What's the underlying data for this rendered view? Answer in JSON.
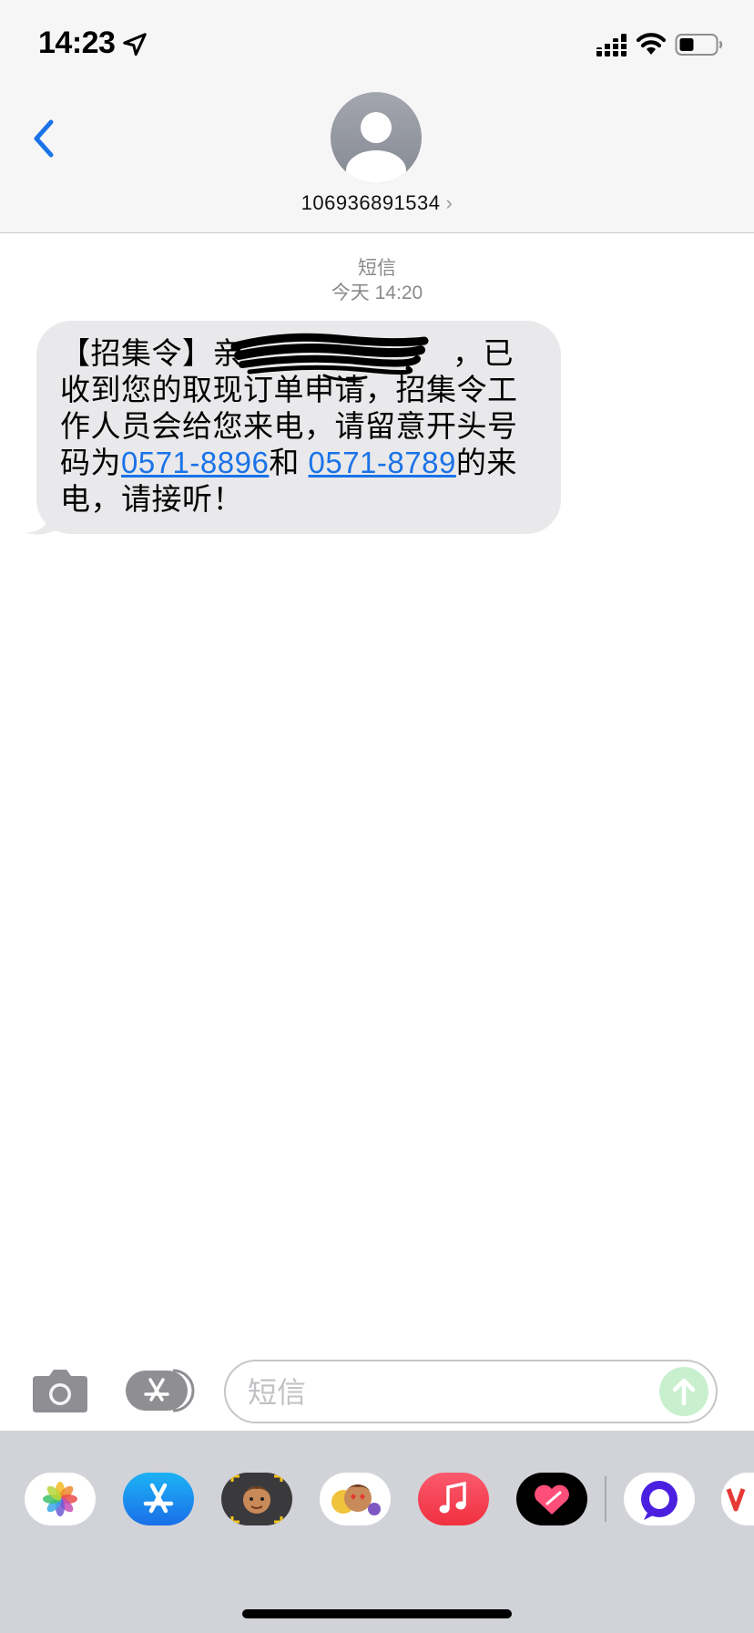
{
  "status_bar": {
    "time": "14:23",
    "icons": [
      "location-arrow-icon",
      "signal-icon",
      "wifi-icon",
      "battery-icon"
    ]
  },
  "header": {
    "back_icon": "chevron-left-icon",
    "avatar_icon": "person-icon",
    "contact": "106936891534",
    "contact_chevron": "›"
  },
  "thread": {
    "service_label": "短信",
    "timestamp": "今天 14:20",
    "message": {
      "part1": "【招集令】亲",
      "part2": "，已收到您的取现订单申请，招集令工作人员会给您来电，请留意开头号码为",
      "link1": "0571-8896",
      "part3": "和",
      "link2": "0571-8789",
      "part4": "的来电，请接听！"
    }
  },
  "input_bar": {
    "camera_icon": "camera-icon",
    "apps_icon": "app-store-icon",
    "placeholder": "短信",
    "send_icon": "arrow-up-icon"
  },
  "app_drawer": {
    "apps": [
      "photos-icon",
      "app-store-icon",
      "memoji-icon",
      "animoji-icon",
      "music-icon",
      "digital-touch-icon",
      "chat-app-icon",
      "partial-app-icon"
    ]
  },
  "colors": {
    "accent": "#1a73e8",
    "bubble": "#e9e9eb",
    "drawer": "#d1d3d9",
    "send_inactive": "#c8f0cf"
  }
}
